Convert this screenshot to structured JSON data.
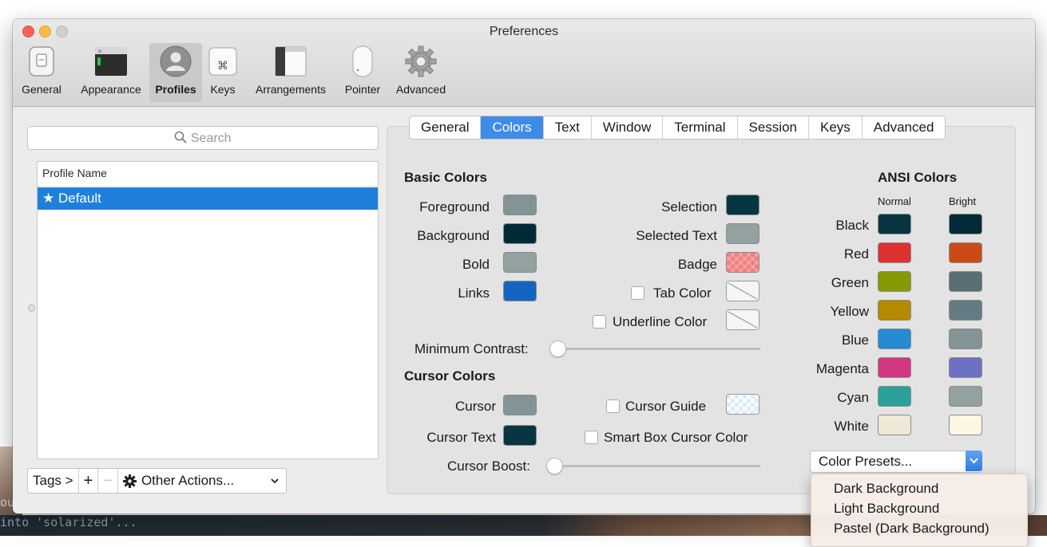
{
  "window": {
    "title": "Preferences"
  },
  "toolbar": {
    "items": [
      {
        "label": "General",
        "icon": "general-switch-icon"
      },
      {
        "label": "Appearance",
        "icon": "appearance-terminal-icon"
      },
      {
        "label": "Profiles",
        "icon": "profiles-user-icon",
        "selected": true
      },
      {
        "label": "Keys",
        "icon": "command-key-icon"
      },
      {
        "label": "Arrangements",
        "icon": "arrangements-window-icon"
      },
      {
        "label": "Pointer",
        "icon": "mouse-icon"
      },
      {
        "label": "Advanced",
        "icon": "gear-icon"
      }
    ]
  },
  "profiles": {
    "search_placeholder": "Search",
    "column_header": "Profile Name",
    "items": [
      {
        "label": "★ Default",
        "selected": true
      }
    ],
    "bottom_bar": {
      "tags": "Tags >",
      "add": "+",
      "remove": "−",
      "other_actions": "Other Actions..."
    }
  },
  "tabs": [
    "General",
    "Colors",
    "Text",
    "Window",
    "Terminal",
    "Session",
    "Keys",
    "Advanced"
  ],
  "active_tab": "Colors",
  "basic_colors": {
    "title": "Basic Colors",
    "foreground": {
      "label": "Foreground",
      "color": "#839496"
    },
    "background": {
      "label": "Background",
      "color": "#002b36"
    },
    "bold": {
      "label": "Bold",
      "color": "#93a1a1"
    },
    "links": {
      "label": "Links",
      "color": "#1565c0"
    },
    "selection": {
      "label": "Selection",
      "color": "#073642"
    },
    "selected_text": {
      "label": "Selected Text",
      "color": "#93a1a1"
    },
    "badge": {
      "label": "Badge",
      "color": "#f08080"
    },
    "tab_color": {
      "label": "Tab Color",
      "checked": false
    },
    "underline_color": {
      "label": "Underline Color",
      "checked": false
    },
    "minimum_contrast": {
      "label": "Minimum Contrast:",
      "value": 0
    }
  },
  "cursor_colors": {
    "title": "Cursor Colors",
    "cursor": {
      "label": "Cursor",
      "color": "#839496"
    },
    "cursor_text": {
      "label": "Cursor Text",
      "color": "#073642"
    },
    "cursor_guide": {
      "label": "Cursor Guide",
      "checked": false
    },
    "smart_box": {
      "label": "Smart Box Cursor Color",
      "checked": false
    },
    "cursor_boost": {
      "label": "Cursor Boost:",
      "value": 0
    }
  },
  "ansi_colors": {
    "title": "ANSI Colors",
    "normal_label": "Normal",
    "bright_label": "Bright",
    "rows": [
      {
        "label": "Black",
        "normal": "#073642",
        "bright": "#002b36"
      },
      {
        "label": "Red",
        "normal": "#dc322f",
        "bright": "#cb4b16"
      },
      {
        "label": "Green",
        "normal": "#859900",
        "bright": "#586e75"
      },
      {
        "label": "Yellow",
        "normal": "#b58900",
        "bright": "#657b83"
      },
      {
        "label": "Blue",
        "normal": "#268bd2",
        "bright": "#839496"
      },
      {
        "label": "Magenta",
        "normal": "#d33682",
        "bright": "#6c71c4"
      },
      {
        "label": "Cyan",
        "normal": "#2aa198",
        "bright": "#93a1a1"
      },
      {
        "label": "White",
        "normal": "#eee8d5",
        "bright": "#fdf6e3"
      }
    ]
  },
  "color_presets": {
    "label": "Color Presets...",
    "menu_items": [
      "Dark Background",
      "Light Background",
      "Pastel (Dark Background)"
    ]
  },
  "terminal_background": {
    "line1": "ou",
    "line2": "into 'solarized'..."
  }
}
